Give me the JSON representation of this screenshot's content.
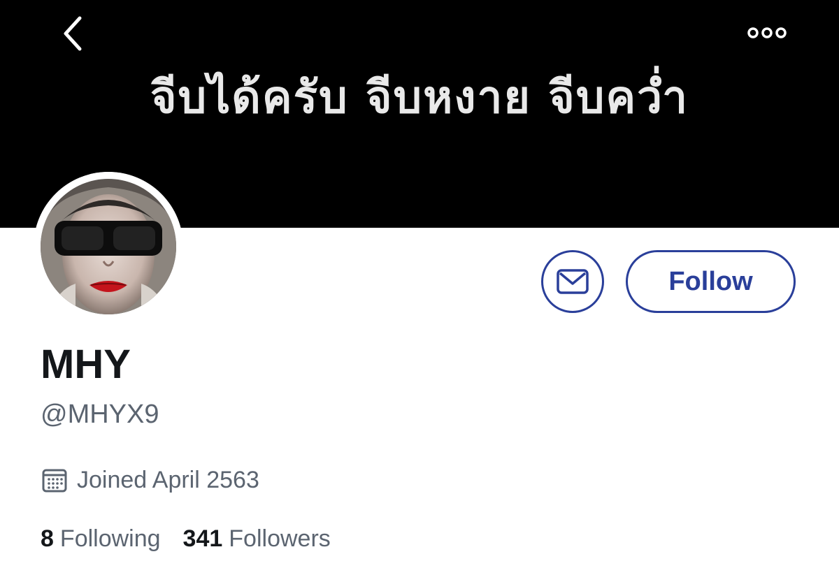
{
  "header": {
    "banner_text": "จีบได้ครับ จีบหงาย จีบคว่ำ",
    "back_icon": "chevron-left-icon",
    "more_icon": "more-dots-icon"
  },
  "profile": {
    "display_name": "MHY",
    "handle": "@MHYX9",
    "joined": "Joined April 2563",
    "following_count": "8",
    "following_label": "Following",
    "followers_count": "341",
    "followers_label": "Followers"
  },
  "actions": {
    "message_icon": "envelope-icon",
    "follow_label": "Follow"
  },
  "colors": {
    "accent": "#2a3f9a",
    "banner_bg": "#000000",
    "text_primary": "#14171a",
    "text_secondary": "#5b6470"
  }
}
